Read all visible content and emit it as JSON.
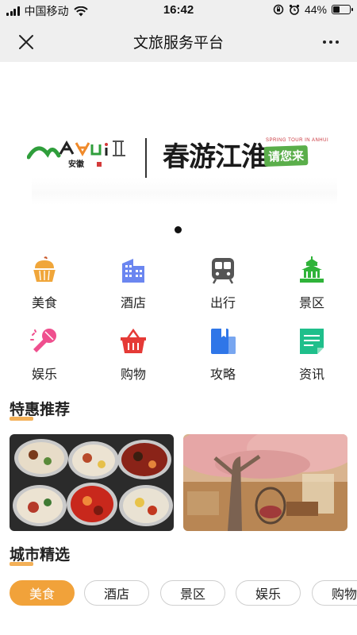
{
  "status_bar": {
    "carrier": "中国移动",
    "time": "16:42",
    "battery_percent": "44%",
    "battery_level": 0.44
  },
  "nav": {
    "title": "文旅服务平台"
  },
  "banner": {
    "title": "春游江淮",
    "subtitle_en": "SPRING TOUR IN ANHUI",
    "badge": "请您来",
    "logo_caption": "安徽",
    "active_slide": 1,
    "slide_count": 1
  },
  "categories": [
    {
      "label": "美食",
      "icon": "cake-icon",
      "color": "#f0a63a"
    },
    {
      "label": "酒店",
      "icon": "hotel-building-icon",
      "color": "#6b86f0"
    },
    {
      "label": "出行",
      "icon": "train-icon",
      "color": "#555555"
    },
    {
      "label": "景区",
      "icon": "temple-icon",
      "color": "#2fb339"
    },
    {
      "label": "娱乐",
      "icon": "microphone-icon",
      "color": "#ef4f8e"
    },
    {
      "label": "购物",
      "icon": "shopping-basket-icon",
      "color": "#e53a36"
    },
    {
      "label": "攻略",
      "icon": "guide-book-icon",
      "color": "#2f76e8"
    },
    {
      "label": "资讯",
      "icon": "news-document-icon",
      "color": "#1fbf8b"
    }
  ],
  "sections": {
    "deals_title": "特惠推荐",
    "city_title": "城市精选"
  },
  "promos": [
    {
      "name": "hotpot-promo-image"
    },
    {
      "name": "cherry-blossom-restaurant-promo-image"
    }
  ],
  "city_tags": [
    {
      "label": "美食",
      "active": true
    },
    {
      "label": "酒店",
      "active": false
    },
    {
      "label": "景区",
      "active": false
    },
    {
      "label": "娱乐",
      "active": false
    },
    {
      "label": "购物",
      "active": false
    }
  ],
  "colors": {
    "accent": "#f1a23a",
    "nav_bg": "#efefef"
  }
}
